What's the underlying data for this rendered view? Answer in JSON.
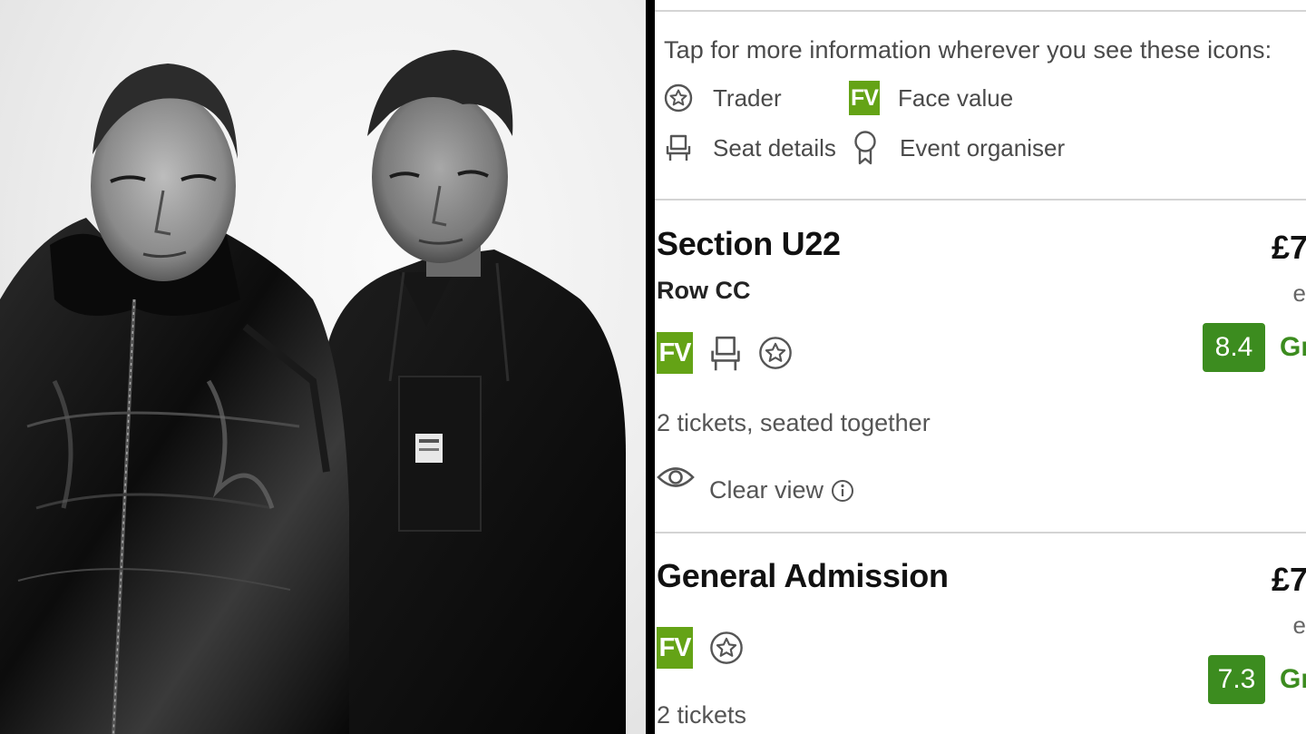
{
  "legend": {
    "title": "Tap for more information wherever you see these icons:",
    "items": [
      {
        "icon": "star-circle-icon",
        "label": "Trader"
      },
      {
        "icon": "fv-badge-icon",
        "label": "Face value",
        "badge": "FV"
      },
      {
        "icon": "seat-icon",
        "label": "Seat details"
      },
      {
        "icon": "award-ribbon-icon",
        "label": "Event organiser"
      }
    ]
  },
  "listings": [
    {
      "section": "Section U22",
      "row": "Row CC",
      "badge": "FV",
      "tickets": "2 tickets, seated together",
      "view": "Clear view",
      "price": "£7",
      "price_sub": "e",
      "score": "8.4",
      "score_label": "Gr"
    },
    {
      "section": "General Admission",
      "badge": "FV",
      "tickets": "2 tickets",
      "price": "£7",
      "price_sub": "e",
      "score": "7.3",
      "score_label": "Gr"
    }
  ],
  "colors": {
    "face_value_green": "#64a316",
    "score_green": "#3c8c1f",
    "divider": "#000000",
    "separator": "#d4d4d4"
  }
}
